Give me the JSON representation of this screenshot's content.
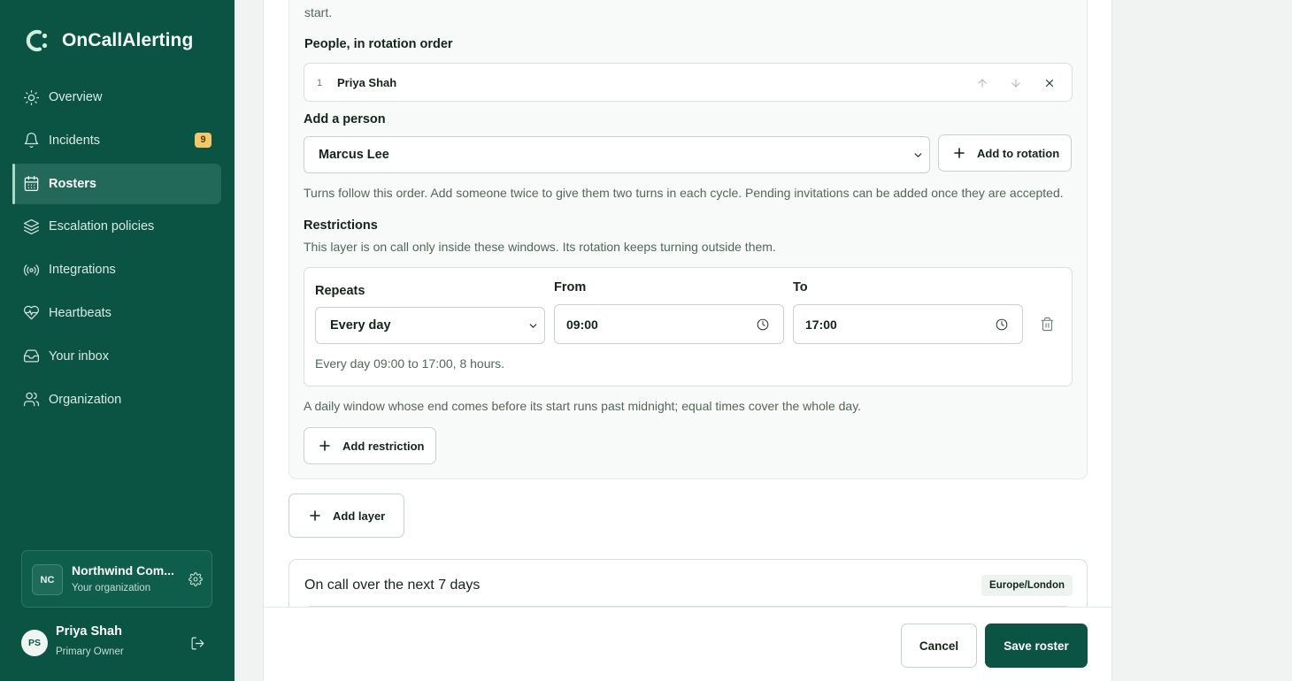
{
  "app": {
    "name": "OnCallAlerting"
  },
  "colors": {
    "sidebar": "#0b5443",
    "accent": "#0b5443",
    "badge": "#f2c86b"
  },
  "nav": [
    {
      "label": "Overview",
      "icon": "sun-icon"
    },
    {
      "label": "Incidents",
      "icon": "bell-icon",
      "badge": "9"
    },
    {
      "label": "Rosters",
      "icon": "calendar-icon",
      "active": true
    },
    {
      "label": "Escalation policies",
      "icon": "layers-icon"
    },
    {
      "label": "Integrations",
      "icon": "broadcast-icon"
    },
    {
      "label": "Heartbeats",
      "icon": "heart-pulse-icon"
    },
    {
      "label": "Your inbox",
      "icon": "inbox-icon"
    },
    {
      "label": "Organization",
      "icon": "users-icon"
    }
  ],
  "org": {
    "initials": "NC",
    "name": "Northwind Com...",
    "subtitle": "Your organization"
  },
  "user": {
    "initials": "PS",
    "name": "Priya Shah",
    "role": "Primary Owner"
  },
  "layer": {
    "intro_tail": "start.",
    "people_label": "People, in rotation order",
    "people": [
      {
        "order": "1",
        "name": "Priya Shah"
      }
    ],
    "add_person_label": "Add a person",
    "add_person_selected": "Marcus Lee",
    "add_to_rotation_label": "Add to rotation",
    "rotation_hint": "Turns follow this order. Add someone twice to give them two turns in each cycle. Pending invitations can be added once they are accepted.",
    "restrictions_label": "Restrictions",
    "restrictions_hint": "This layer is on call only inside these windows. Its rotation keeps turning outside them.",
    "restriction": {
      "repeats_label": "Repeats",
      "repeats_value": "Every day",
      "from_label": "From",
      "from_value": "09:00",
      "to_label": "To",
      "to_value": "17:00",
      "summary": "Every day 09:00 to 17:00, 8 hours."
    },
    "midnight_hint": "A daily window whose end comes before its start runs past midnight; equal times cover the whole day.",
    "add_restriction_label": "Add restriction"
  },
  "add_layer_label": "Add layer",
  "oncall": {
    "title": "On call over the next 7 days",
    "timezone": "Europe/London"
  },
  "footer": {
    "cancel_label": "Cancel",
    "save_label": "Save roster"
  }
}
